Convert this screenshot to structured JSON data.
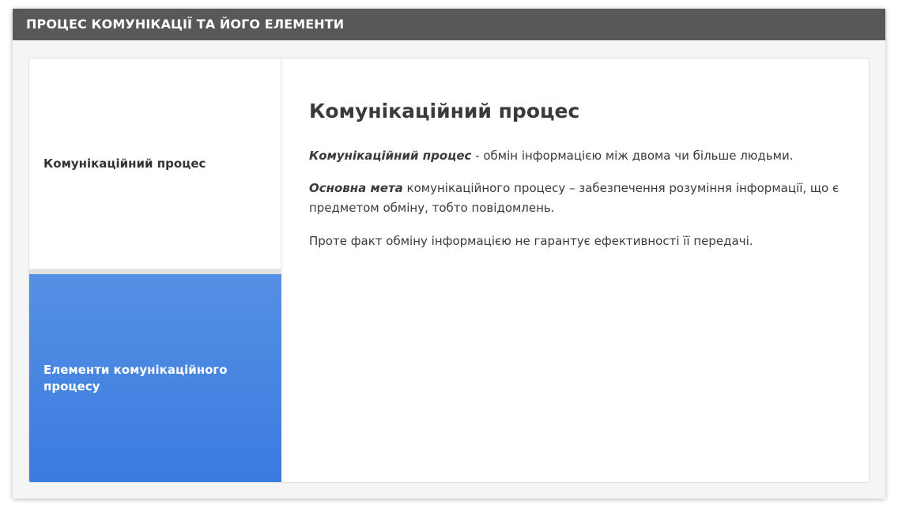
{
  "header": {
    "title": "ПРОЦЕС КОМУНІКАЦІЇ ТА ЙОГО ЕЛЕМЕНТИ"
  },
  "tabs": [
    {
      "label": "Комунікаційний процес",
      "active": true
    },
    {
      "label": "Елементи комунікаційного процесу",
      "active": false
    }
  ],
  "content": {
    "heading": "Комунікаційний процес",
    "para1_term": "Комунікаційний процес",
    "para1_text": " - обмін інформацією між двома чи більше людьми.",
    "para2_term": "Основна мета",
    "para2_text": " комунікаційного процесу – забезпечення розуміння інформації, що є предметом обміну, тобто повідомлень.",
    "para3_text": "Проте факт обміну інформацією не гарантує ефективності її передачі."
  },
  "colors": {
    "title_bar": "#585858",
    "tab_active_bg": "#ffffff",
    "tab_inactive_bg": "#3a7be0",
    "text": "#3a3a3a"
  }
}
